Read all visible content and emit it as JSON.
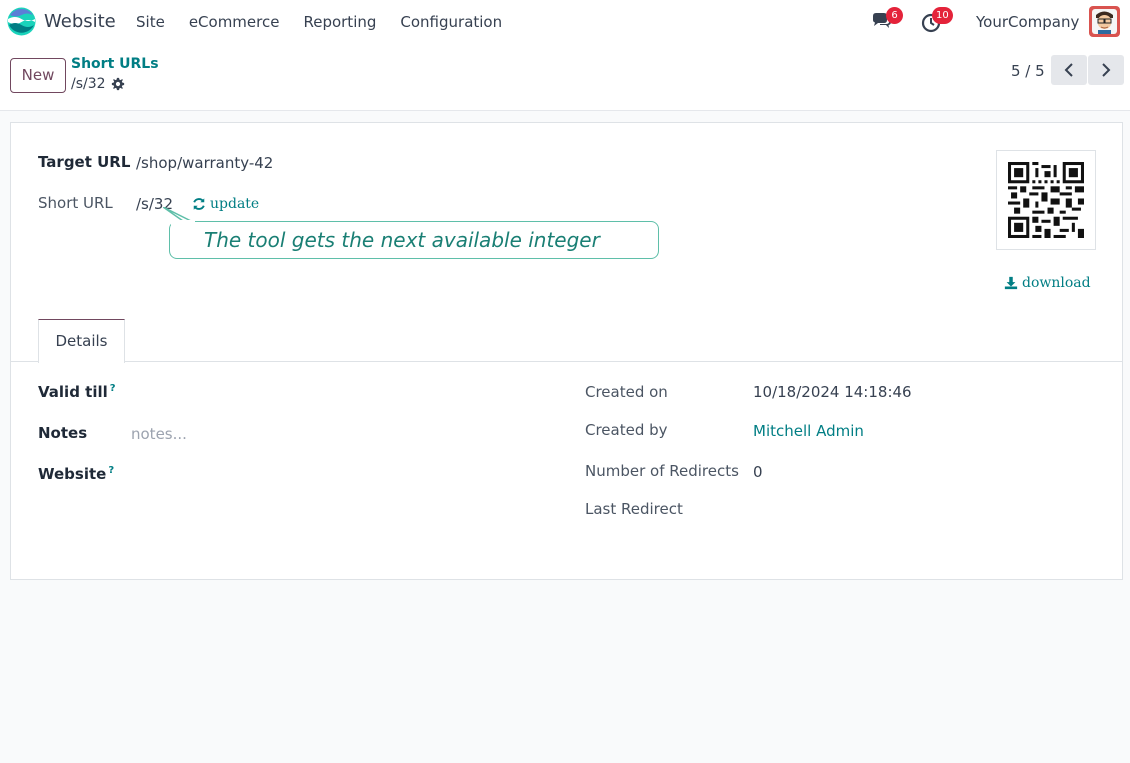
{
  "navbar": {
    "app_name": "Website",
    "menu": [
      "Site",
      "eCommerce",
      "Reporting",
      "Configuration"
    ],
    "messages_count": "6",
    "activities_count": "10",
    "company": "YourCompany"
  },
  "control": {
    "new_label": "New",
    "breadcrumb_parent": "Short URLs",
    "breadcrumb_current": "/s/32",
    "pager": "5 / 5"
  },
  "form": {
    "target_url_label": "Target URL",
    "target_url_value": "/shop/warranty-42",
    "short_url_label": "Short URL",
    "short_url_value": "/s/32",
    "update_label": "update",
    "callout_text": "The tool gets the next available integer",
    "download_label": "download",
    "tab_details": "Details",
    "valid_till_label": "Valid till",
    "notes_label": "Notes",
    "notes_placeholder": "notes...",
    "website_label": "Website",
    "help_mark": "?",
    "created_on_label": "Created on",
    "created_on_value": "10/18/2024 14:18:46",
    "created_by_label": "Created by",
    "created_by_value": "Mitchell Admin",
    "redirects_label": "Number of Redirects",
    "redirects_value": "0",
    "last_redirect_label": "Last Redirect"
  },
  "colors": {
    "brand": "#71485f",
    "link": "#017e84",
    "badge": "#e4233a",
    "callout_border": "#5fbfa9"
  }
}
